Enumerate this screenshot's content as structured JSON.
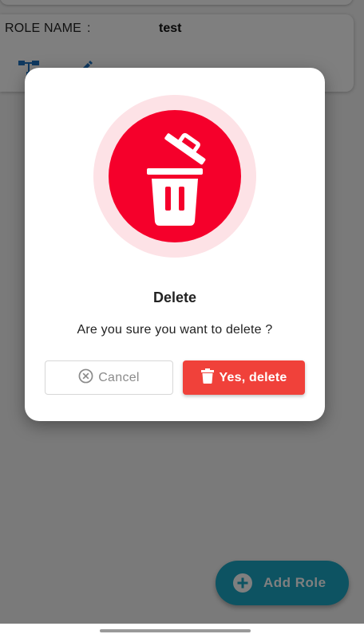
{
  "role_card": {
    "label": "ROLE NAME",
    "colon": ":",
    "value": "test",
    "actions": [
      "tree-structure-icon",
      "edit-pencil-icon"
    ]
  },
  "fab": {
    "label": "Add Role",
    "icon": "plus-circle-icon"
  },
  "dialog": {
    "icon": "trash-open-icon",
    "title": "Delete",
    "message": "Are you sure you want to delete ?",
    "cancel_label": "Cancel",
    "cancel_icon": "close-circle-icon",
    "confirm_label": "Yes, delete",
    "confirm_icon": "trash-icon"
  },
  "colors": {
    "danger": "#f5002b",
    "danger_halo": "#fde2e6",
    "confirm_button": "#f0413a",
    "fab": "#1aa6c4",
    "role_icon": "#1e73c0"
  }
}
